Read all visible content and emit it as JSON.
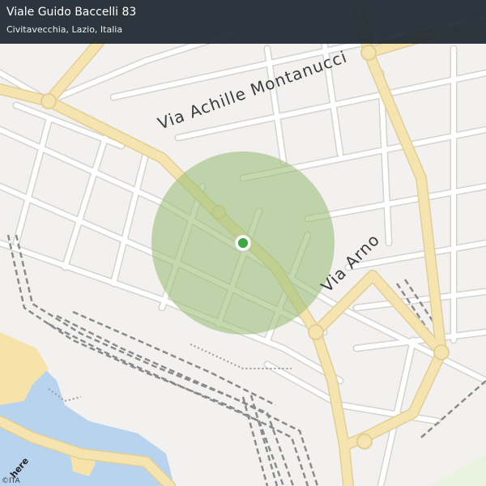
{
  "header": {
    "title": "Viale Guido Baccelli 83",
    "subtitle": "Civitavecchia, Lazio, Italia"
  },
  "map": {
    "street_labels": [
      "Via Achille Montanucci",
      "Via Arno"
    ],
    "radius_color": "#9dc07b",
    "marker_color": "#3aa83a",
    "main_road_color": "#f5e4b0",
    "water_color": "#b8d3ee",
    "beach_color": "#f6e3a9"
  },
  "footer": {
    "brand": "here",
    "copyright": "©ITA"
  }
}
